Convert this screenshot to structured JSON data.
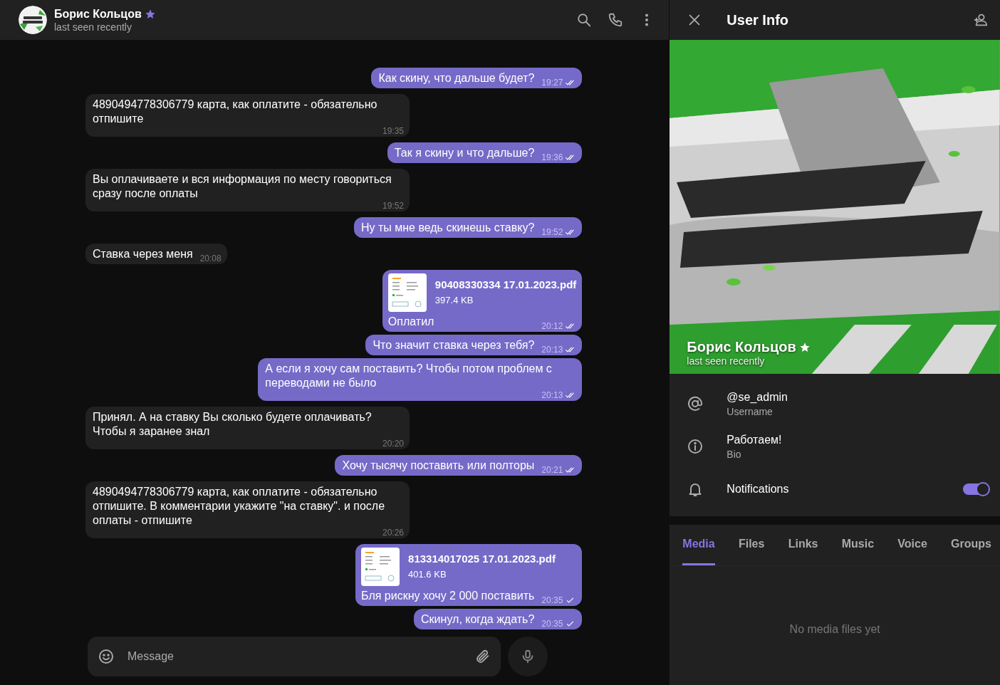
{
  "chat_header": {
    "name": "Борис Кольцов",
    "premium": true,
    "status": "last seen recently"
  },
  "messages": [
    {
      "kind": "out",
      "text": "Как скину, что дальше будет?",
      "time": "19:27",
      "read": true
    },
    {
      "kind": "in",
      "text": "4890494778306779 карта, как оплатите - обязательно отпишите",
      "time": "19:35"
    },
    {
      "kind": "out",
      "text": "Так я скину и что дальше?",
      "time": "19:36",
      "read": true
    },
    {
      "kind": "in",
      "text": "Вы оплачиваете и вся информация по месту говориться сразу после оплаты",
      "time": "19:52"
    },
    {
      "kind": "out",
      "text": "Ну ты мне ведь скинешь ставку?",
      "time": "19:52",
      "read": true
    },
    {
      "kind": "in",
      "text": "Ставка через меня",
      "time": "20:08"
    },
    {
      "kind": "file",
      "file_name": "90408330334 17.01.2023.pdf",
      "file_size": "397.4 KB",
      "text": "Оплатил",
      "time": "20:12",
      "read": true
    },
    {
      "kind": "out",
      "text": "Что значит ставка через тебя?",
      "time": "20:13",
      "read": true
    },
    {
      "kind": "out",
      "text": "А если я хочу сам поставить? Чтобы потом проблем с переводами не было",
      "time": "20:13",
      "read": true
    },
    {
      "kind": "in",
      "text": "Принял. А на ставку Вы сколько будете оплачивать? Чтобы я заранее знал",
      "time": "20:20"
    },
    {
      "kind": "out",
      "text": "Хочу тысячу поставить или полторы",
      "time": "20:21",
      "read": true
    },
    {
      "kind": "in",
      "text": "4890494778306779 карта, как оплатите - обязательно отпишите. В комментарии укажите \"на ставку\".  и после оплаты - отпишите",
      "time": "20:26"
    },
    {
      "kind": "file",
      "file_name": "813314017025 17.01.2023.pdf",
      "file_size": "401.6 KB",
      "text": "Бля рискну хочу 2 000 поставить",
      "time": "20:35",
      "read": false
    },
    {
      "kind": "out",
      "text": "Скинул, когда ждать?",
      "time": "20:35",
      "read": false
    }
  ],
  "composer": {
    "placeholder": "Message"
  },
  "user_info": {
    "title": "User Info",
    "name": "Борис Кольцов",
    "premium": true,
    "status": "last seen recently",
    "rows": [
      {
        "kind": "username",
        "value": "@se_admin",
        "label": "Username"
      },
      {
        "kind": "bio",
        "value": "Работаем!",
        "label": "Bio"
      },
      {
        "kind": "notifications",
        "value": "Notifications",
        "on": true
      }
    ],
    "tabs": [
      {
        "label": "Media",
        "selected": true
      },
      {
        "label": "Files",
        "selected": false
      },
      {
        "label": "Links",
        "selected": false
      },
      {
        "label": "Music",
        "selected": false
      },
      {
        "label": "Voice",
        "selected": false
      },
      {
        "label": "Groups",
        "selected": false
      }
    ],
    "empty_text": "No media files yet"
  }
}
